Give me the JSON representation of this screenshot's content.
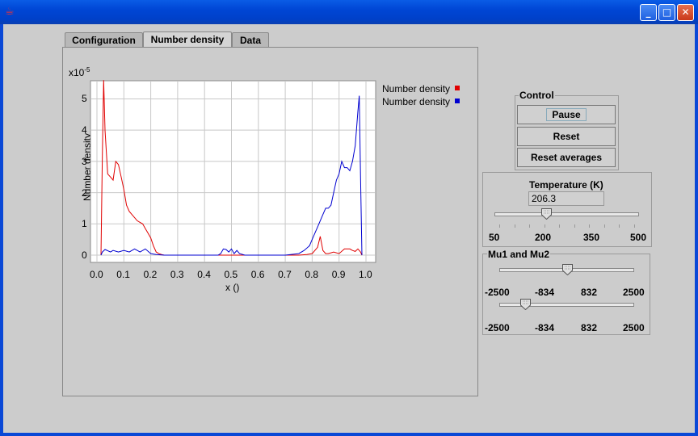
{
  "window": {
    "icon": "java-cup-icon"
  },
  "tabs": [
    {
      "label": "Configuration"
    },
    {
      "label": "Number density"
    },
    {
      "label": "Data"
    }
  ],
  "chart_data": {
    "type": "line",
    "title": "",
    "xlabel": "x ()",
    "ylabel": "Number density",
    "y_multiplier": "x10",
    "y_exponent": "-5",
    "xlim": [
      0.0,
      1.0
    ],
    "ylim": [
      0,
      5.4
    ],
    "x_ticks": [
      "0.0",
      "0.1",
      "0.2",
      "0.3",
      "0.4",
      "0.5",
      "0.6",
      "0.7",
      "0.8",
      "0.9",
      "1.0"
    ],
    "y_ticks": [
      "0",
      "1",
      "2",
      "3",
      "4",
      "5"
    ],
    "grid": true,
    "legend_position": "right",
    "series": [
      {
        "name": "Number density",
        "color": "#e00000",
        "x": [
          0.015,
          0.02,
          0.025,
          0.03,
          0.04,
          0.05,
          0.06,
          0.07,
          0.08,
          0.09,
          0.1,
          0.11,
          0.12,
          0.13,
          0.14,
          0.15,
          0.16,
          0.17,
          0.18,
          0.19,
          0.2,
          0.21,
          0.22,
          0.23,
          0.24,
          0.25,
          0.3,
          0.4,
          0.5,
          0.6,
          0.7,
          0.75,
          0.78,
          0.8,
          0.82,
          0.83,
          0.84,
          0.85,
          0.86,
          0.88,
          0.9,
          0.92,
          0.94,
          0.95,
          0.96,
          0.97,
          0.98,
          0.985
        ],
        "values": [
          0,
          3.2,
          5.6,
          4.0,
          2.6,
          2.5,
          2.4,
          3.0,
          2.9,
          2.5,
          2.1,
          1.6,
          1.4,
          1.3,
          1.2,
          1.1,
          1.05,
          1.0,
          0.85,
          0.7,
          0.55,
          0.3,
          0.1,
          0.05,
          0.02,
          0,
          0,
          0,
          0,
          0,
          0,
          0,
          0.02,
          0.05,
          0.25,
          0.6,
          0.15,
          0.05,
          0.05,
          0.1,
          0.05,
          0.2,
          0.2,
          0.15,
          0.12,
          0.2,
          0.1,
          0
        ]
      },
      {
        "name": "Number density",
        "color": "#0000d0",
        "x": [
          0.015,
          0.02,
          0.03,
          0.05,
          0.06,
          0.08,
          0.1,
          0.12,
          0.14,
          0.16,
          0.18,
          0.2,
          0.22,
          0.25,
          0.3,
          0.4,
          0.45,
          0.46,
          0.47,
          0.48,
          0.49,
          0.5,
          0.51,
          0.52,
          0.53,
          0.55,
          0.6,
          0.7,
          0.72,
          0.75,
          0.77,
          0.79,
          0.8,
          0.81,
          0.82,
          0.83,
          0.84,
          0.85,
          0.86,
          0.87,
          0.88,
          0.89,
          0.9,
          0.91,
          0.92,
          0.93,
          0.94,
          0.95,
          0.96,
          0.97,
          0.975,
          0.98,
          0.985
        ],
        "values": [
          0,
          0.1,
          0.18,
          0.1,
          0.15,
          0.1,
          0.15,
          0.1,
          0.2,
          0.1,
          0.2,
          0.05,
          0.02,
          0,
          0,
          0,
          0,
          0.05,
          0.2,
          0.18,
          0.1,
          0.2,
          0.05,
          0.15,
          0.05,
          0,
          0,
          0,
          0.02,
          0.05,
          0.15,
          0.3,
          0.5,
          0.7,
          0.9,
          1.1,
          1.3,
          1.5,
          1.5,
          1.6,
          2.0,
          2.4,
          2.6,
          3.0,
          2.8,
          2.8,
          2.7,
          3.0,
          3.5,
          4.6,
          5.1,
          2.5,
          0
        ]
      }
    ]
  },
  "control": {
    "title": "Control",
    "pause_label": "Pause",
    "reset_label": "Reset",
    "reset_averages_label": "Reset averages"
  },
  "temperature": {
    "title": "Temperature (K)",
    "value": "206.3",
    "slider_value": 206.3,
    "min": 50,
    "max": 500,
    "tick_labels": [
      "50",
      "200",
      "350",
      "500"
    ]
  },
  "mu": {
    "title": "Mu1 and Mu2",
    "min": -2500,
    "max": 2500,
    "slider1_value": 0,
    "slider2_value": -1670,
    "tick_labels": [
      "-2500",
      "-834",
      "832",
      "2500"
    ]
  }
}
